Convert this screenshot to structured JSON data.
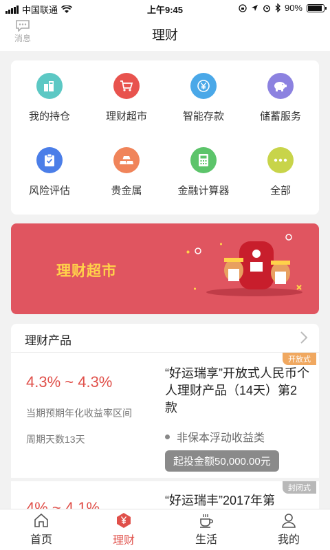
{
  "status_bar": {
    "carrier": "中国联通",
    "time": "上午9:45",
    "battery": "90%",
    "battery_level": 0.9
  },
  "header": {
    "message_label": "消息",
    "title": "理财"
  },
  "entries": [
    {
      "label": "我的持仓",
      "icon": "holdings-icon",
      "color": "#5cc8c4"
    },
    {
      "label": "理财超市",
      "icon": "shopping-cart-icon",
      "color": "#e8534e"
    },
    {
      "label": "智能存款",
      "icon": "yen-coin-icon",
      "color": "#4aa8e8"
    },
    {
      "label": "储蓄服务",
      "icon": "piggy-bank-icon",
      "color": "#8c82e0"
    },
    {
      "label": "风险评估",
      "icon": "clipboard-check-icon",
      "color": "#4b7ee8"
    },
    {
      "label": "贵金属",
      "icon": "gold-bars-icon",
      "color": "#f0845a"
    },
    {
      "label": "金融计算器",
      "icon": "calculator-icon",
      "color": "#5cc46a"
    },
    {
      "label": "全部",
      "icon": "more-dots-icon",
      "color": "#c8d44a"
    }
  ],
  "banner": {
    "title": "理财超市",
    "background": "#e05560"
  },
  "products": {
    "section_title": "理财产品",
    "items": [
      {
        "tag": "开放式",
        "tag_color": "#f0a860",
        "rate": "4.3% ~ 4.3%",
        "rate_desc": "当期预期年化收益率区间",
        "term": "周期天数13天",
        "name": "“好运瑞享”开放式人民币个人理财产品（14天）第2款",
        "type": "非保本浮动收益类",
        "min_invest": "起投金额50,000.00元"
      },
      {
        "tag": "封闭式",
        "tag_color": "#b8b8b8",
        "rate": "4% ~ 4.1%",
        "name": "“好运瑞丰”2017年第"
      }
    ]
  },
  "tabbar": [
    {
      "label": "首页",
      "icon": "home-icon",
      "active": false
    },
    {
      "label": "理财",
      "icon": "wealth-yen-icon",
      "active": true
    },
    {
      "label": "生活",
      "icon": "coffee-cup-icon",
      "active": false
    },
    {
      "label": "我的",
      "icon": "user-icon",
      "active": false
    }
  ],
  "accent_color": "#e0504a"
}
